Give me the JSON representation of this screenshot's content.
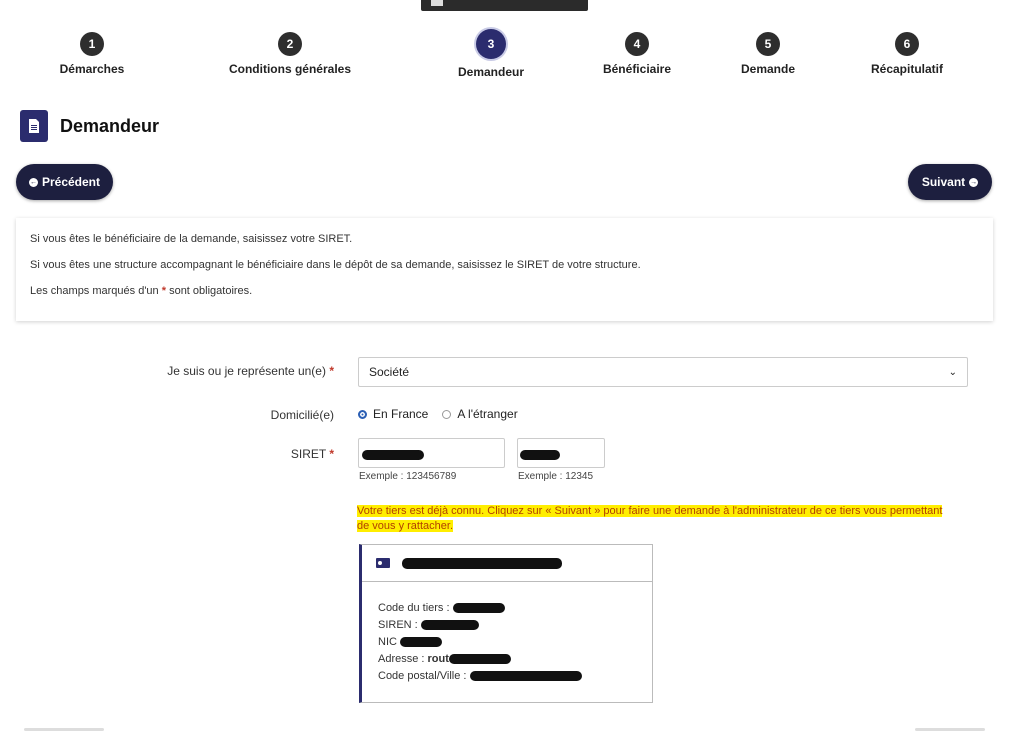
{
  "stepper": [
    {
      "number": "1",
      "label": "Démarches"
    },
    {
      "number": "2",
      "label": "Conditions générales"
    },
    {
      "number": "3",
      "label": "Demandeur"
    },
    {
      "number": "4",
      "label": "Bénéficiaire"
    },
    {
      "number": "5",
      "label": "Demande"
    },
    {
      "number": "6",
      "label": "Récapitulatif"
    }
  ],
  "page": {
    "title": "Demandeur"
  },
  "nav": {
    "prev_label": "Précédent",
    "next_label": "Suivant"
  },
  "info": {
    "line1": "Si vous êtes le bénéficiaire de la demande, saisissez votre SIRET.",
    "line2": "Si vous êtes une structure accompagnant le bénéficiaire dans le dépôt de sa demande, saisissez le SIRET de votre structure.",
    "line3_prefix": "Les champs marqués d'un ",
    "line3_star": "*",
    "line3_suffix": " sont obligatoires."
  },
  "form": {
    "represent_label": "Je suis ou je représente un(e)",
    "represent_value": "Société",
    "domicile_label": "Domicilié(e)",
    "domicile_options": [
      "En France",
      "A l'étranger"
    ],
    "siret_label": "SIRET",
    "siret_hint": "Exemple : 123456789",
    "nic_hint": "Exemple : 12345",
    "required_star": "*"
  },
  "warning": "Votre tiers est déjà connu. Cliquez sur « Suivant » pour faire une demande à l'administrateur de ce tiers vous permettant de vous y rattacher.",
  "tiers": {
    "code_label": "Code du tiers : ",
    "siren_label": "SIREN : ",
    "nic_label": "NIC ",
    "address_label": "Adresse : ",
    "address_partial": "rout",
    "postal_label": "Code postal/Ville : "
  },
  "colors": {
    "primary": "#2b2c6e",
    "button": "#1d1f3f",
    "warning_bg": "#ffee00",
    "warning_text": "#b24000",
    "required": "#c0392b"
  }
}
